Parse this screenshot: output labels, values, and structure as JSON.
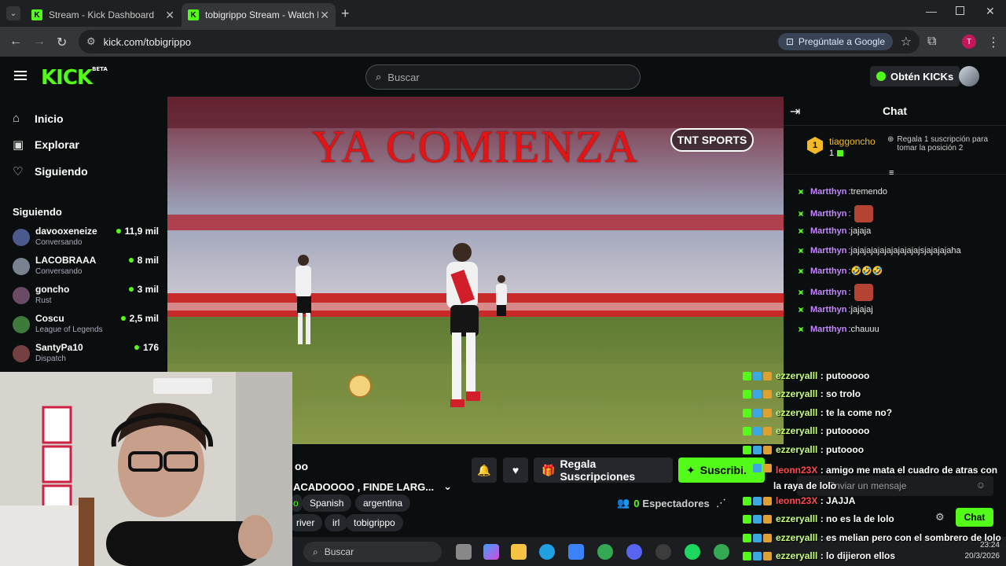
{
  "browser": {
    "tabs": [
      {
        "title": "Stream - Kick Dashboard"
      },
      {
        "title": "tobigrippo Stream - Watch Live"
      }
    ],
    "url": "kick.com/tobigrippo",
    "ask_google": "Pregúntale a Google",
    "profile_initial": "T"
  },
  "header": {
    "logo": "KICK",
    "logo_beta": "BETA",
    "search_placeholder": "Buscar",
    "get_kicks": "Obtén KICKs"
  },
  "sidebar": {
    "nav": [
      {
        "label": "Inicio",
        "icon": "home-icon"
      },
      {
        "label": "Explorar",
        "icon": "compass-icon"
      },
      {
        "label": "Siguiendo",
        "icon": "heart-icon"
      }
    ],
    "following_title": "Siguiendo",
    "channels": [
      {
        "name": "davooxeneize",
        "category": "Conversando",
        "viewers": "11,9 mil",
        "color": "#4b5a8c"
      },
      {
        "name": "LACOBRAAA",
        "category": "Conversando",
        "viewers": "8 mil",
        "color": "#7a8290"
      },
      {
        "name": "goncho",
        "category": "Rust",
        "viewers": "3 mil",
        "color": "#6b4b63"
      },
      {
        "name": "Coscu",
        "category": "League of Legends",
        "viewers": "2,5 mil",
        "color": "#3e7a3c"
      },
      {
        "name": "SantyPa10",
        "category": "Dispatch",
        "viewers": "176",
        "color": "#744040"
      }
    ]
  },
  "video": {
    "headline": "YA COMIENZA",
    "broadcaster_logo": "TNT SPORTS"
  },
  "stream_info": {
    "title_fragment": "oo",
    "stream_title": "ACADOOOO , FINDE LARG...",
    "tags_row1": [
      "o",
      "Spanish",
      "argentina"
    ],
    "tags_row2": [
      "river",
      "irl",
      "tobigrippo"
    ],
    "gift_label": "Regala Suscripciones",
    "subscribe_label": "Suscribir",
    "viewers_count": "0",
    "viewers_label": "Espectadores"
  },
  "chat": {
    "title": "Chat",
    "pinned": {
      "rank": "1",
      "user": "tiaggoncho",
      "count": "1",
      "cta": "Regala 1 suscripción para tomar la posición 2"
    },
    "messages": [
      {
        "user": "Martthyn",
        "text": "tremendo",
        "emote": false
      },
      {
        "user": "Martthyn",
        "text": "",
        "emote": true
      },
      {
        "user": "Martthyn",
        "text": "jajaja",
        "emote": false
      },
      {
        "user": "Martthyn",
        "text": "jajajajajajajajajajajsjajajajaha",
        "emote": false
      },
      {
        "user": "Martthyn",
        "text": "🤣🤣🤣",
        "emote": false
      },
      {
        "user": "Martthyn",
        "text": "",
        "emote": true
      },
      {
        "user": "Martthyn",
        "text": "jajajaj",
        "emote": false
      },
      {
        "user": "Martthyn",
        "text": "chauuu",
        "emote": false
      }
    ],
    "input_placeholder": "Enviar un mensaje",
    "send_label": "Chat"
  },
  "overlay_chat": [
    {
      "user": "ezzeryalll",
      "text": "putooooo",
      "red": false
    },
    {
      "user": "ezzeryalll",
      "text": "so trolo",
      "red": false
    },
    {
      "user": "ezzeryalll",
      "text": "te la come no?",
      "red": false
    },
    {
      "user": "ezzeryalll",
      "text": "putooooo",
      "red": false
    },
    {
      "user": "ezzeryalll",
      "text": "putoooo",
      "red": false
    },
    {
      "user": "leonn23X",
      "text": "amigo me mata el cuadro de atras con la raya de lolo",
      "red": true
    },
    {
      "user": "leonn23X",
      "text": "JAJJA",
      "red": true
    },
    {
      "user": "ezzeryalll",
      "text": "no es la de lolo",
      "red": false
    },
    {
      "user": "ezzeryalll",
      "text": "es melian pero con el sombrero de lolo",
      "red": false
    },
    {
      "user": "ezzeryalll",
      "text": "lo dijieron ellos",
      "red": false
    }
  ],
  "taskbar": {
    "search_placeholder": "Buscar",
    "time": "23:24",
    "date": "20/3/2026"
  },
  "colors": {
    "kick_green": "#53fc18",
    "background": "#0b0e0f",
    "chat_user": "#c586ff"
  }
}
